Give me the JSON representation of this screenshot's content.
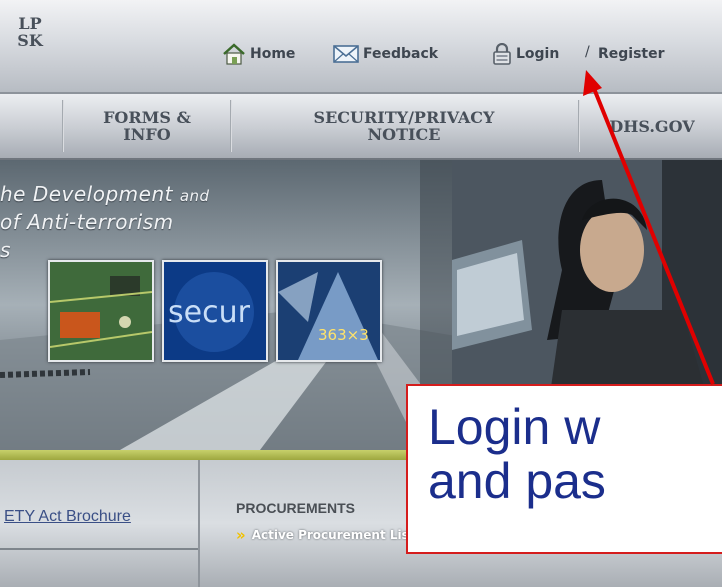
{
  "top_links": {
    "home": "Home",
    "feedback": "Feedback",
    "login": "Login",
    "slash": "/",
    "register": "Register"
  },
  "nav_tabs": [
    {
      "line1": "LP",
      "line2": "SK"
    },
    {
      "line1": "FORMS &",
      "line2": "INFO"
    },
    {
      "line1": "SECURITY/PRIVACY",
      "line2": "NOTICE"
    },
    {
      "line1": "DHS.GOV",
      "line2": ""
    }
  ],
  "banner": {
    "tagline_line1_a": "he Development",
    "tagline_line1_b": "and",
    "tagline_line2": "of Anti-terrorism",
    "tagline_line3": "s",
    "thumb_security_text": "secur",
    "thumb_size_label": "363×3"
  },
  "bottom": {
    "brochure_link": "ETY Act Brochure",
    "procurements_title": "PROCUREMENTS",
    "procurements_link": "Active Procurement List"
  },
  "callout": {
    "line1": "Login w",
    "line2": "and pas"
  },
  "colors": {
    "callout_border": "#d51d1d",
    "callout_text": "#1b2e8c",
    "arrow": "#e00000",
    "olive_bar": "#b3bb52"
  }
}
